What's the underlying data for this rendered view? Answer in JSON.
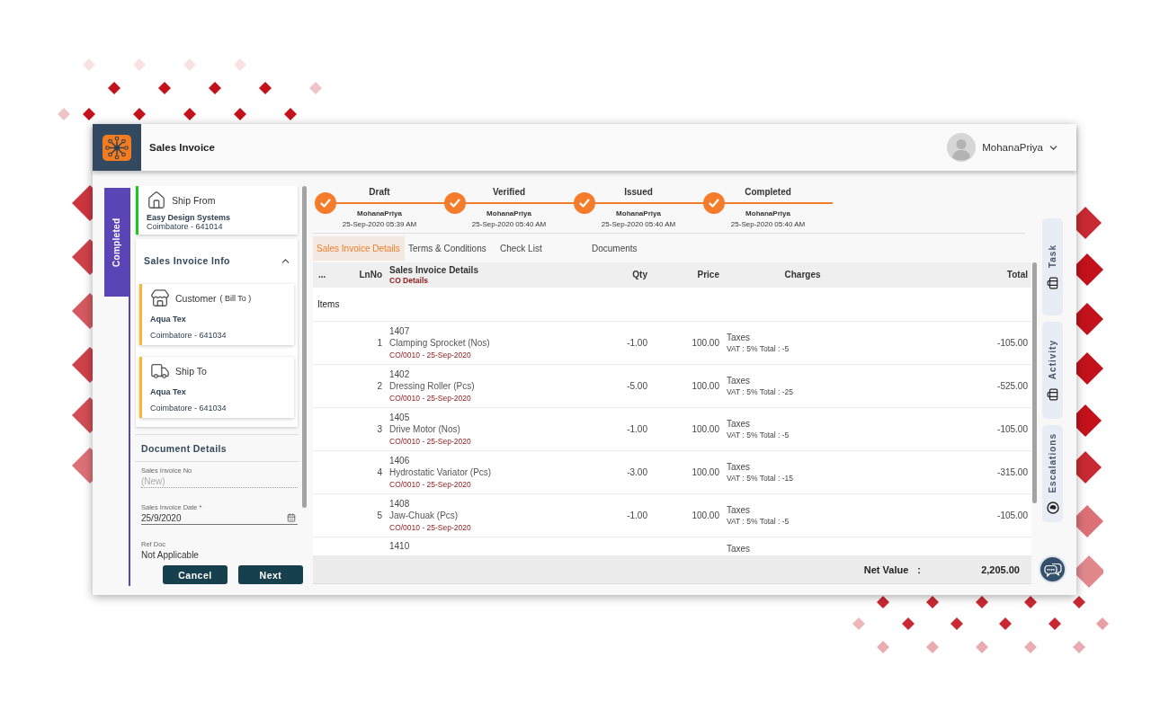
{
  "app": {
    "title": "Sales Invoice",
    "user": {
      "name": "MohanaPriya"
    }
  },
  "stage": {
    "label": "Completed"
  },
  "ship_from": {
    "title": "Ship From",
    "name": "Easy Design Systems",
    "address": "Coimbatore - 641014"
  },
  "sales_invoice_info": {
    "title": "Sales Invoice Info",
    "expanded": true,
    "parties": [
      {
        "kind": "customer",
        "title": "Customer",
        "qualifier": "( Bill To )",
        "name": "Aqua Tex",
        "address": "Coimbatore - 641034"
      },
      {
        "kind": "ship_to",
        "title": "Ship To",
        "name": "Aqua Tex",
        "address": "Coimbatore - 641034"
      }
    ]
  },
  "document_details": {
    "title": "Document Details",
    "fields": [
      {
        "kind": "text",
        "label": "Sales Invoice No",
        "placeholder": "(New)",
        "disabled": true
      },
      {
        "kind": "date",
        "label": "Sales Invoice Date *",
        "value": "25/9/2020",
        "disabled": false
      },
      {
        "kind": "static",
        "label": "Ref Doc",
        "value": "Not Applicable",
        "disabled": false
      }
    ]
  },
  "actions": [
    {
      "label": "Cancel"
    },
    {
      "label": "Next"
    }
  ],
  "workflow": {
    "steps": [
      {
        "title": "Draft",
        "user": "MohanaPriya",
        "time": "25-Sep-2020 05:39 AM",
        "done": true
      },
      {
        "title": "Verified",
        "user": "MohanaPriya",
        "time": "25-Sep-2020 05:40 AM",
        "done": true
      },
      {
        "title": "Issued",
        "user": "MohanaPriya",
        "time": "25-Sep-2020 05:40 AM",
        "done": true
      },
      {
        "title": "Completed",
        "user": "MohanaPriya",
        "time": "25-Sep-2020 05:40 AM",
        "done": true
      }
    ]
  },
  "tabs": [
    {
      "label": "Sales Invoice Details",
      "selected": true
    },
    {
      "label": "Terms & Conditions",
      "selected": false
    },
    {
      "label": "Check List",
      "selected": false
    },
    {
      "label": "Documents",
      "selected": false
    }
  ],
  "table": {
    "columns": [
      {
        "label": "..."
      },
      {
        "label": "LnNo"
      },
      {
        "label": "Sales Invoice Details",
        "sublabel": "CO Details"
      },
      {
        "label": "Qty"
      },
      {
        "label": "Price"
      },
      {
        "label": "Charges"
      },
      {
        "label": "Total"
      }
    ],
    "group": "Items",
    "rows": [
      {
        "kind": "item",
        "ln": "1",
        "code": "1407",
        "name": "Clamping Sprocket (Nos)",
        "co_ref": "CO/0010 - 25-Sep-2020",
        "qty": "-1.00",
        "price": "100.00",
        "charges_title": "Taxes",
        "charges_detail": "VAT : 5% Total : -5",
        "total": "-105.00"
      },
      {
        "kind": "item",
        "ln": "2",
        "code": "1402",
        "name": "Dressing Roller (Pcs)",
        "co_ref": "CO/0010 - 25-Sep-2020",
        "qty": "-5.00",
        "price": "100.00",
        "charges_title": "Taxes",
        "charges_detail": "VAT : 5% Total : -25",
        "total": "-525.00"
      },
      {
        "kind": "item",
        "ln": "3",
        "code": "1405",
        "name": "Drive Motor (Nos)",
        "co_ref": "CO/0010 - 25-Sep-2020",
        "qty": "-1.00",
        "price": "100.00",
        "charges_title": "Taxes",
        "charges_detail": "VAT : 5% Total : -5",
        "total": "-105.00"
      },
      {
        "kind": "item",
        "ln": "4",
        "code": "1406",
        "name": "Hydrostatic Variator (Pcs)",
        "co_ref": "CO/0010 - 25-Sep-2020",
        "qty": "-3.00",
        "price": "100.00",
        "charges_title": "Taxes",
        "charges_detail": "VAT : 5% Total : -15",
        "total": "-315.00"
      },
      {
        "kind": "item",
        "ln": "5",
        "code": "1408",
        "name": "Jaw-Chuak (Pcs)",
        "co_ref": "CO/0010 - 25-Sep-2020",
        "qty": "-1.00",
        "price": "100.00",
        "charges_title": "Taxes",
        "charges_detail": "VAT : 5% Total : -5",
        "total": "-105.00"
      },
      {
        "kind": "partial",
        "code": "1410",
        "charges_title": "Taxes"
      }
    ]
  },
  "summary": {
    "label": "Net Value",
    "separator": ":",
    "value": "2,205.00"
  },
  "side_tabs": [
    {
      "kind": "task",
      "label": "Task"
    },
    {
      "kind": "activity",
      "label": "Activity"
    },
    {
      "kind": "escalations",
      "label": "Escalations"
    }
  ]
}
